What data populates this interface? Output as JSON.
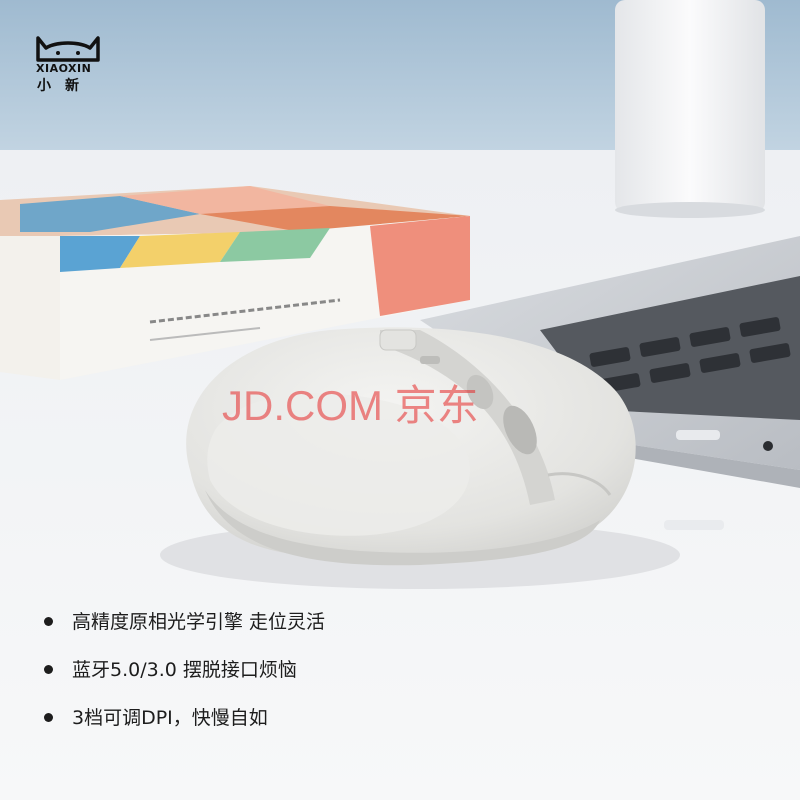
{
  "brand": {
    "name_en": "XIAOXIN",
    "name_cn": "小新",
    "logo_icon": "cat-ears-logo-icon"
  },
  "watermark": {
    "text": "JD.COM 京东",
    "color": "#e62828"
  },
  "features": [
    {
      "text": "高精度原相光学引擎 走位灵活"
    },
    {
      "text": "蓝牙5.0/3.0 摆脱接口烦恼"
    },
    {
      "text": "3档可调DPI，快慢自如"
    }
  ],
  "colors": {
    "background": "#f4f5f7",
    "wall": "#a9c3d8",
    "mouse": "#e8e8e6",
    "laptop": "#c9ccd1"
  }
}
